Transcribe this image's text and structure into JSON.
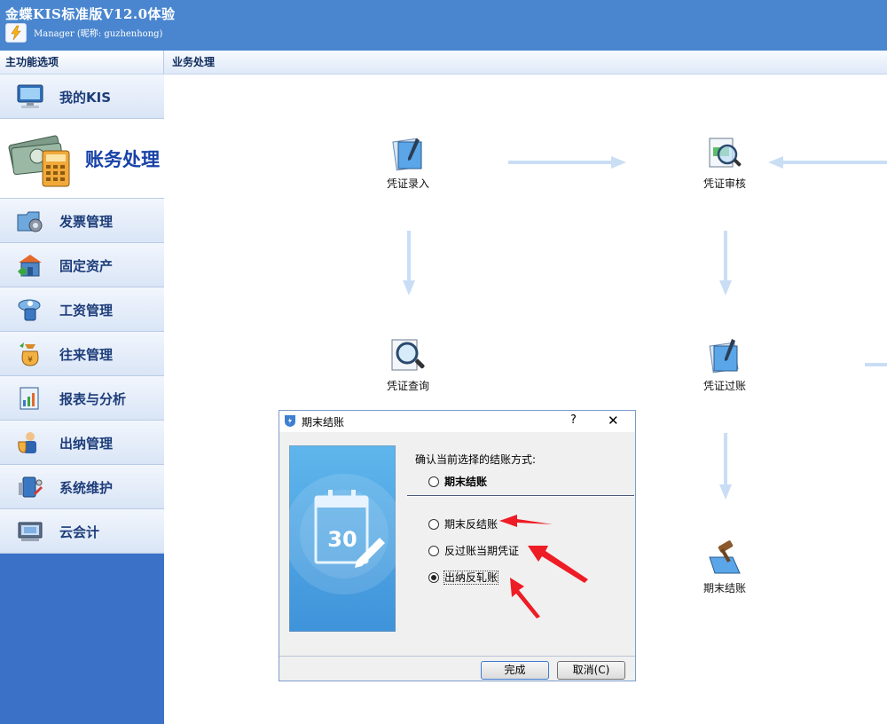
{
  "app": {
    "title": "金蝶KIS标准版V12.0体验",
    "user": "Manager (昵称: guzhenhong)"
  },
  "sidebar": {
    "header": "主功能选项",
    "items": [
      {
        "label": "我的KIS",
        "icon": "monitor-icon"
      },
      {
        "label": "账务处理",
        "icon": "calculator-money-icon",
        "active": true
      },
      {
        "label": "发票管理",
        "icon": "invoice-folder-icon"
      },
      {
        "label": "固定资产",
        "icon": "building-icon"
      },
      {
        "label": "工资管理",
        "icon": "payroll-icon"
      },
      {
        "label": "往来管理",
        "icon": "money-bag-icon"
      },
      {
        "label": "报表与分析",
        "icon": "report-icon"
      },
      {
        "label": "出纳管理",
        "icon": "cashier-icon"
      },
      {
        "label": "系统维护",
        "icon": "tools-icon"
      },
      {
        "label": "云会计",
        "icon": "cloud-computer-icon"
      }
    ]
  },
  "main": {
    "header": "业务处理",
    "nodes": {
      "entry": "凭证录入",
      "audit": "凭证审核",
      "query": "凭证查询",
      "posting": "凭证过账",
      "closing": "期末结账"
    }
  },
  "dialog": {
    "title": "期末结账",
    "help": "?",
    "close": "✕",
    "question": "确认当前选择的结账方式:",
    "image_text": "30",
    "options": [
      {
        "label": "期末结账",
        "selected": false
      },
      {
        "label": "期末反结账",
        "selected": false
      },
      {
        "label": "反过账当期凭证",
        "selected": false
      },
      {
        "label": "出纳反轧账",
        "selected": true
      }
    ],
    "ok": "完成",
    "cancel": "取消(C)"
  },
  "colors": {
    "titlebar": "#4a86cf",
    "sidebar": "#3b72c8",
    "flow_arrow": "#c9def5",
    "annotation_arrow": "#ee1c25"
  }
}
